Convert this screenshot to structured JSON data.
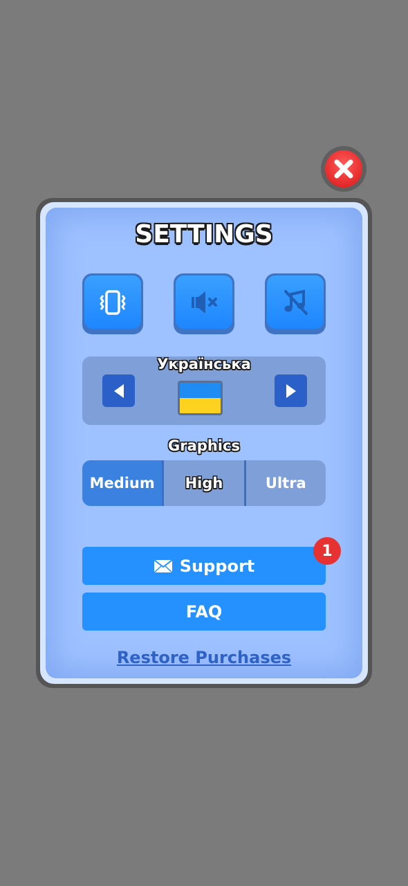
{
  "title": "SETTINGS",
  "toggles": [
    {
      "name": "vibration",
      "icon": "vibration-icon"
    },
    {
      "name": "sound",
      "icon": "speaker-muted-icon"
    },
    {
      "name": "music",
      "icon": "music-off-icon"
    }
  ],
  "language": {
    "label": "Українська",
    "flag": "ukraine-flag",
    "flag_colors": [
      "#1f8cf3",
      "#ffd21f"
    ]
  },
  "graphics": {
    "label": "Graphics",
    "options": [
      "Medium",
      "High",
      "Ultra"
    ],
    "selected": "High"
  },
  "support": {
    "label": "Support",
    "icon": "envelope-icon",
    "badge": "1"
  },
  "faq": {
    "label": "FAQ"
  },
  "restore": {
    "label": "Restore Purchases"
  },
  "colors": {
    "panel": "#9ec1ff",
    "button": "#2590ff",
    "close": "#e52a2a",
    "badge": "#e73232",
    "link": "#2e62c6"
  }
}
